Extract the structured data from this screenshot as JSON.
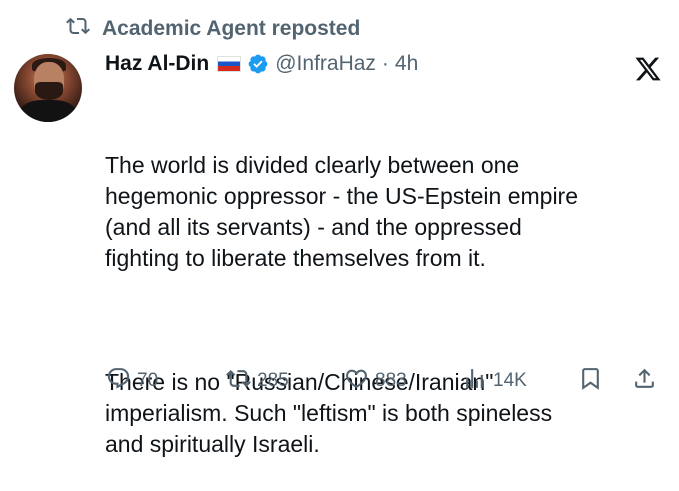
{
  "repost_label": "Academic Agent reposted",
  "author": {
    "name": "Haz Al-Din",
    "handle": "@InfraHaz",
    "separator": "·",
    "time": "4h"
  },
  "tweet": {
    "paragraph1": "The world is divided clearly between one\nhegemonic oppressor - the US-Epstein empire\n(and all its servants) - and the oppressed\nfighting to liberate themselves from it.",
    "paragraph2": "There is no \"Russian/Chinese/Iranian\"\nimperialism. Such \"leftism\" is both spineless\nand spiritually Israeli."
  },
  "actions": {
    "replies": "70",
    "reposts": "285",
    "likes": "883",
    "views": "14K"
  },
  "colors": {
    "text": "#0f1419",
    "muted": "#536471",
    "verified": "#1d9bf0"
  },
  "icons": [
    "repost-icon",
    "flag-russia-icon",
    "verified-badge-icon",
    "x-logo-icon",
    "reply-icon",
    "like-icon",
    "views-icon",
    "bookmark-icon",
    "share-icon"
  ]
}
